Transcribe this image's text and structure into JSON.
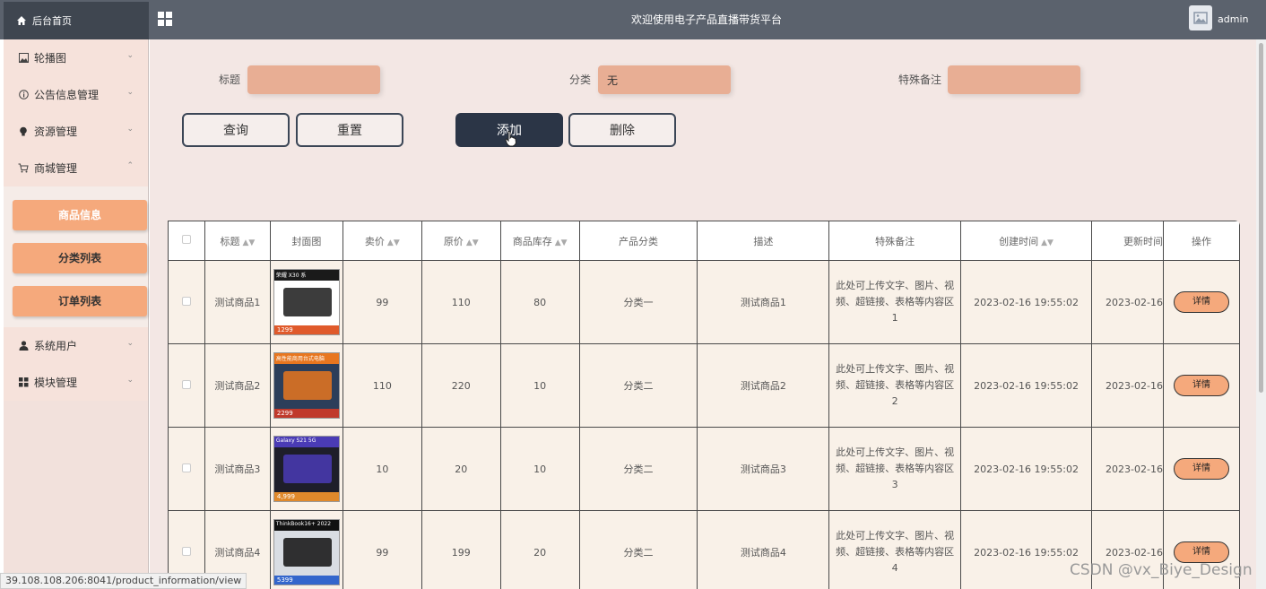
{
  "header": {
    "home_label": "后台首页",
    "site_title": "欢迎使用电子产品直播带货平台",
    "username": "admin"
  },
  "sidebar": {
    "items": [
      {
        "label": "轮播图",
        "icon": "image-icon"
      },
      {
        "label": "公告信息管理",
        "icon": "info-icon"
      },
      {
        "label": "资源管理",
        "icon": "bulb-icon"
      },
      {
        "label": "商城管理",
        "icon": "cart-icon"
      }
    ],
    "submenu": [
      "商品信息",
      "分类列表",
      "订单列表"
    ],
    "items_after": [
      {
        "label": "系统用户",
        "icon": "user-icon"
      },
      {
        "label": "模块管理",
        "icon": "grid-icon"
      }
    ]
  },
  "filters": {
    "title_label": "标题",
    "title_value": "",
    "category_label": "分类",
    "category_value": "无",
    "note_label": "特殊备注",
    "note_value": ""
  },
  "buttons": {
    "query": "查询",
    "reset": "重置",
    "add": "添加",
    "delete": "删除"
  },
  "table": {
    "headers": [
      "标题",
      "封面图",
      "卖价",
      "原价",
      "商品库存",
      "产品分类",
      "描述",
      "特殊备注",
      "创建时间",
      "更新时间",
      "操作"
    ],
    "detail_label": "详情",
    "rows": [
      {
        "title": "测试商品1",
        "price": "99",
        "orig": "110",
        "stock": "80",
        "category": "分类一",
        "desc": "测试商品1",
        "note": "此处可上传文字、图片、视频、超链接、表格等内容区1",
        "created": "2023-02-16 19:55:02",
        "updated": "2023-02-16"
      },
      {
        "title": "测试商品2",
        "price": "110",
        "orig": "220",
        "stock": "10",
        "category": "分类二",
        "desc": "测试商品2",
        "note": "此处可上传文字、图片、视频、超链接、表格等内容区2",
        "created": "2023-02-16 19:55:02",
        "updated": "2023-02-16"
      },
      {
        "title": "测试商品3",
        "price": "10",
        "orig": "20",
        "stock": "10",
        "category": "分类二",
        "desc": "测试商品3",
        "note": "此处可上传文字、图片、视频、超链接、表格等内容区3",
        "created": "2023-02-16 19:55:02",
        "updated": "2023-02-16"
      },
      {
        "title": "测试商品4",
        "price": "99",
        "orig": "199",
        "stock": "20",
        "category": "分类二",
        "desc": "测试商品4",
        "note": "此处可上传文字、图片、视频、超链接、表格等内容区4",
        "created": "2023-02-16 19:55:02",
        "updated": "2023-02-16"
      }
    ],
    "thumbs": [
      {
        "top_text": "荣耀 X30 系",
        "price_text": "1299"
      },
      {
        "top_text": "高性能商用台式电脑",
        "price_text": "2299"
      },
      {
        "top_text": "Galaxy S21 5G",
        "price_text": "4,999"
      },
      {
        "top_text": "ThinkBook16+ 2022",
        "price_text": "5399"
      }
    ]
  },
  "status_url": "39.108.108.206:8041/product_information/view",
  "watermark": "CSDN @vx_Biye_Design"
}
